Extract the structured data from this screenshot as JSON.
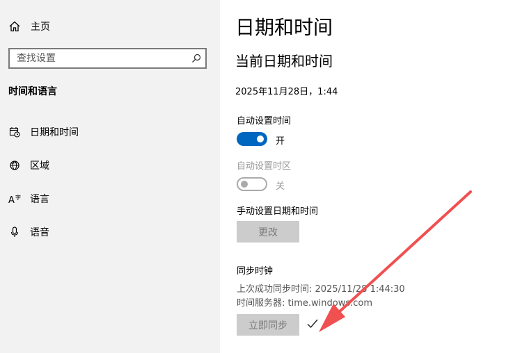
{
  "sidebar": {
    "home_label": "主页",
    "search_placeholder": "查找设置",
    "section_title": "时间和语言",
    "items": [
      {
        "label": "日期和时间",
        "icon": "calendar-clock-icon"
      },
      {
        "label": "区域",
        "icon": "globe-icon"
      },
      {
        "label": "语言",
        "icon": "language-icon"
      },
      {
        "label": "语音",
        "icon": "microphone-icon"
      }
    ]
  },
  "main": {
    "title": "日期和时间",
    "subtitle": "当前日期和时间",
    "current_datetime": "2025年11月28日，1:44",
    "auto_time": {
      "label": "自动设置时间",
      "state": "开",
      "enabled": true
    },
    "auto_timezone": {
      "label": "自动设置时区",
      "state": "关",
      "enabled": false
    },
    "manual": {
      "label": "手动设置日期和时间",
      "button": "更改"
    },
    "sync": {
      "label": "同步时钟",
      "last_sync": "上次成功同步时间: 2025/11/28 1:44:30",
      "server": "时间服务器: time.windows.com",
      "button": "立即同步"
    }
  },
  "colors": {
    "accent": "#0067c0",
    "sidebar_bg": "#f2f2f2",
    "annotation_arrow": "#f05050",
    "disabled_button": "#cccccc"
  }
}
